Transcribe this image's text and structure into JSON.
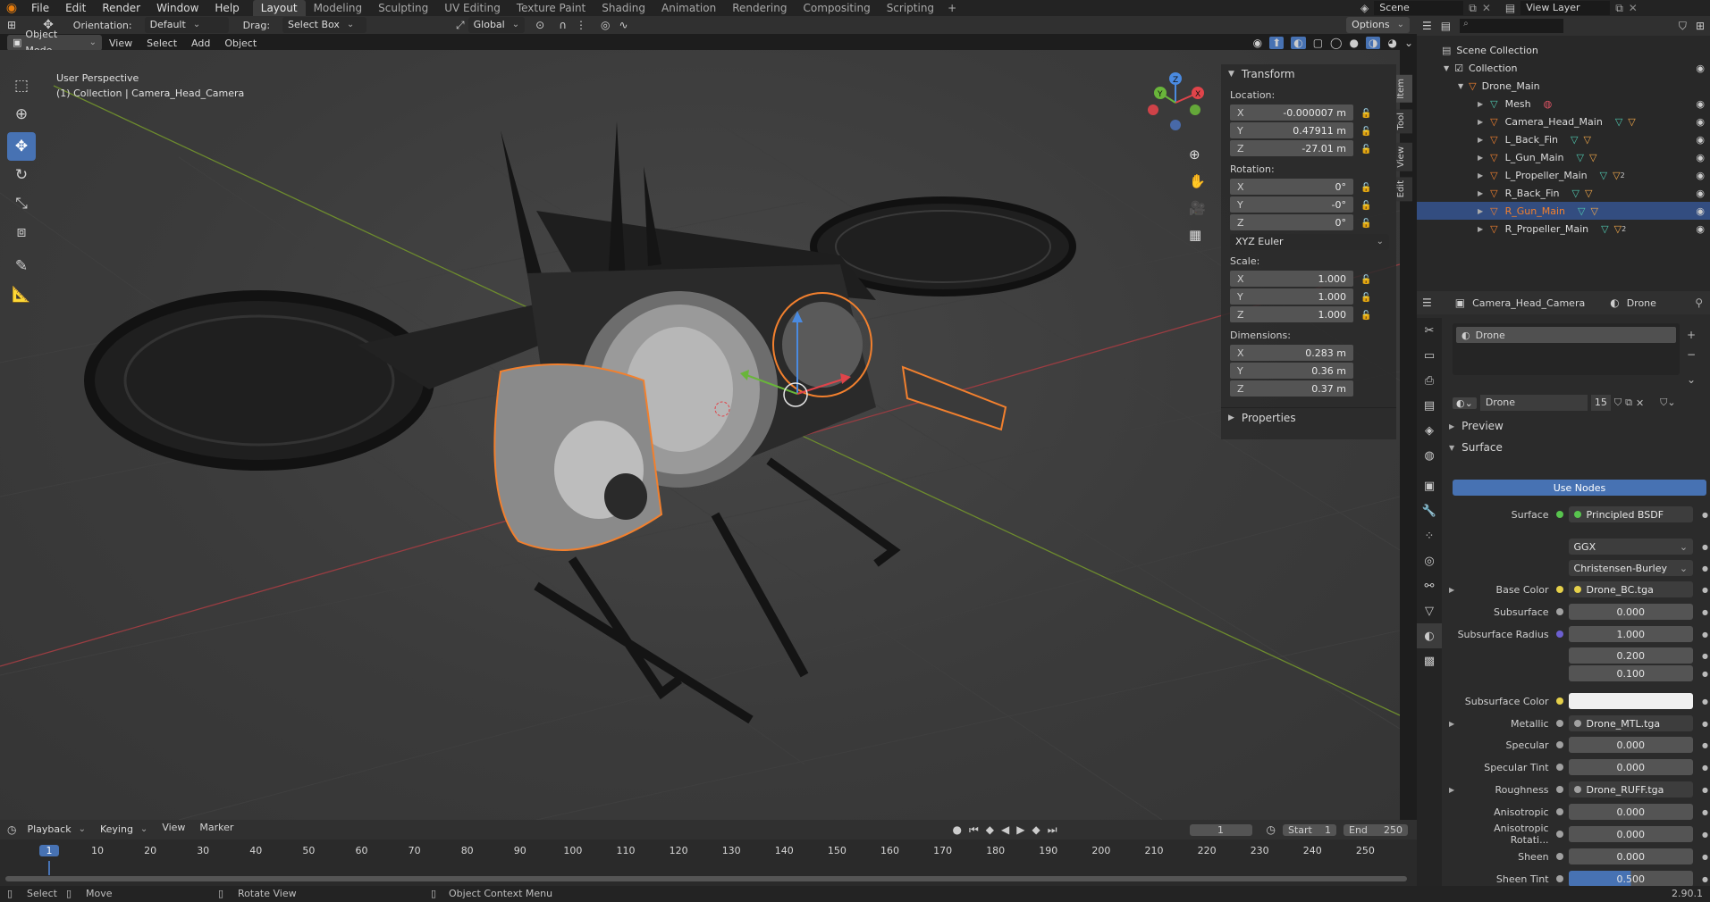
{
  "top_menu": [
    "File",
    "Edit",
    "Render",
    "Window",
    "Help"
  ],
  "workspace_tabs": [
    "Layout",
    "Modeling",
    "Sculpting",
    "UV Editing",
    "Texture Paint",
    "Shading",
    "Animation",
    "Rendering",
    "Compositing",
    "Scripting"
  ],
  "active_workspace": "Layout",
  "add_tab_label": "+",
  "scene_name": "Scene",
  "view_layer": "View Layer",
  "header": {
    "orientation_label": "Orientation:",
    "orientation_value": "Default",
    "drag_label": "Drag:",
    "drag_value": "Select Box",
    "transform_orientation": "Global",
    "options_label": "Options"
  },
  "viewport_menu": {
    "mode": "Object Mode",
    "items": [
      "View",
      "Select",
      "Add",
      "Object"
    ]
  },
  "viewport_info": {
    "line1": "User Perspective",
    "line2": "(1) Collection | Camera_Head_Camera"
  },
  "gizmo_axes": [
    "Z",
    "Y",
    "X"
  ],
  "transform_panel": {
    "title": "Transform",
    "location_label": "Location:",
    "location": [
      {
        "axis": "X",
        "value": "-0.000007 m"
      },
      {
        "axis": "Y",
        "value": "0.47911 m"
      },
      {
        "axis": "Z",
        "value": "-27.01 m"
      }
    ],
    "rotation_label": "Rotation:",
    "rotation": [
      {
        "axis": "X",
        "value": "0°"
      },
      {
        "axis": "Y",
        "value": "-0°"
      },
      {
        "axis": "Z",
        "value": "0°"
      }
    ],
    "rotation_mode": "XYZ Euler",
    "scale_label": "Scale:",
    "scale": [
      {
        "axis": "X",
        "value": "1.000"
      },
      {
        "axis": "Y",
        "value": "1.000"
      },
      {
        "axis": "Z",
        "value": "1.000"
      }
    ],
    "dimensions_label": "Dimensions:",
    "dimensions": [
      {
        "axis": "X",
        "value": "0.283 m"
      },
      {
        "axis": "Y",
        "value": "0.36 m"
      },
      {
        "axis": "Z",
        "value": "0.37 m"
      }
    ],
    "properties_label": "Properties"
  },
  "sidebar_tabs": [
    "Item",
    "Tool",
    "View",
    "Edit"
  ],
  "outliner": {
    "root": "Scene Collection",
    "collection": "Collection",
    "parent": "Drone_Main",
    "items": [
      {
        "name": "Mesh",
        "selected": false
      },
      {
        "name": "Camera_Head_Main",
        "selected": false
      },
      {
        "name": "L_Back_Fin",
        "selected": false
      },
      {
        "name": "L_Gun_Main",
        "selected": false
      },
      {
        "name": "L_Propeller_Main",
        "selected": false,
        "badge": "2"
      },
      {
        "name": "R_Back_Fin",
        "selected": false
      },
      {
        "name": "R_Gun_Main",
        "selected": true
      },
      {
        "name": "R_Propeller_Main",
        "selected": false,
        "badge": "2"
      }
    ]
  },
  "properties": {
    "object_name": "Camera_Head_Camera",
    "material_name": "Drone",
    "slot_name": "Drone",
    "material_field": "Drone",
    "users": "15",
    "preview_label": "Preview",
    "surface_section": "Surface",
    "use_nodes": "Use Nodes",
    "rows": [
      {
        "label": "Surface",
        "value": "Principled BSDF",
        "kind": "link",
        "dot": "#58c44e"
      },
      {
        "label": "",
        "value": "GGX",
        "kind": "dropdown"
      },
      {
        "label": "",
        "value": "Christensen-Burley",
        "kind": "dropdown"
      },
      {
        "label": "Base Color",
        "value": "Drone_BC.tga",
        "kind": "link",
        "dot": "#e5d04a",
        "expand": true
      },
      {
        "label": "Subsurface",
        "value": "0.000",
        "kind": "num",
        "dot": "#a1a1a1"
      },
      {
        "label": "Subsurface Radius",
        "value": "1.000",
        "kind": "num",
        "dot": "#6c5fd0"
      },
      {
        "label": "",
        "value": "0.200",
        "kind": "num"
      },
      {
        "label": "",
        "value": "0.100",
        "kind": "num"
      },
      {
        "label": "Subsurface Color",
        "value": "",
        "kind": "color",
        "dot": "#e5d04a"
      },
      {
        "label": "Metallic",
        "value": "Drone_MTL.tga",
        "kind": "link",
        "dot": "#a1a1a1",
        "expand": true
      },
      {
        "label": "Specular",
        "value": "0.000",
        "kind": "num",
        "dot": "#a1a1a1"
      },
      {
        "label": "Specular Tint",
        "value": "0.000",
        "kind": "num",
        "dot": "#a1a1a1"
      },
      {
        "label": "Roughness",
        "value": "Drone_RUFF.tga",
        "kind": "link",
        "dot": "#a1a1a1",
        "expand": true
      },
      {
        "label": "Anisotropic",
        "value": "0.000",
        "kind": "num",
        "dot": "#a1a1a1"
      },
      {
        "label": "Anisotropic Rotati...",
        "value": "0.000",
        "kind": "num",
        "dot": "#a1a1a1"
      },
      {
        "label": "Sheen",
        "value": "0.000",
        "kind": "num",
        "dot": "#a1a1a1"
      },
      {
        "label": "Sheen Tint",
        "value": "0.500",
        "kind": "slider",
        "dot": "#a1a1a1",
        "fill": 0.5
      }
    ]
  },
  "timeline": {
    "menus": [
      "Playback",
      "Keying",
      "View",
      "Marker"
    ],
    "current_frame": "1",
    "start_label": "Start",
    "start": "1",
    "end_label": "End",
    "end": "250",
    "ticks": [
      "1",
      "10",
      "20",
      "30",
      "40",
      "50",
      "60",
      "70",
      "80",
      "90",
      "100",
      "110",
      "120",
      "130",
      "140",
      "150",
      "160",
      "170",
      "180",
      "190",
      "200",
      "210",
      "220",
      "230",
      "240",
      "250"
    ]
  },
  "statusbar": {
    "select": "Select",
    "move": "Move",
    "rotate": "Rotate View",
    "context": "Object Context Menu",
    "version": "2.90.1"
  },
  "colors": {
    "accent": "#4772b3",
    "selection_outline": "#f2802e",
    "active_tab": "#3d3d3d"
  }
}
